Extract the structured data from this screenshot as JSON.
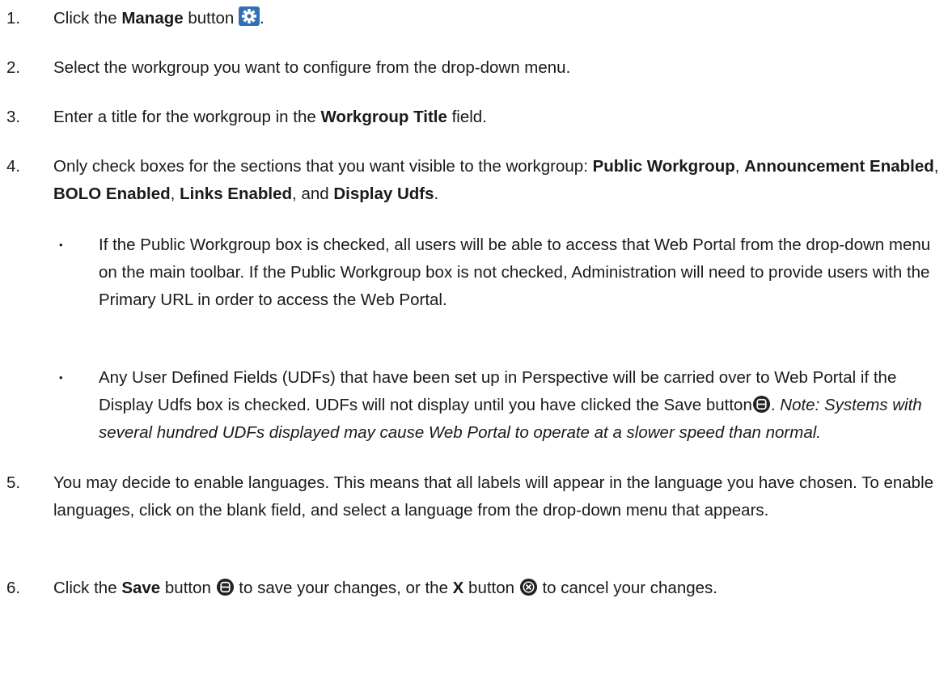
{
  "steps": [
    {
      "num": "1.",
      "pre": "Click the ",
      "bold": "Manage",
      "post": " button",
      "icon": "gear-icon",
      "tail": "."
    },
    {
      "num": "2.",
      "text": "Select the workgroup you want to configure from the drop-down menu."
    },
    {
      "num": "3.",
      "pre": "Enter a title for the workgroup in the ",
      "bold": "Workgroup Title",
      "post": " field."
    },
    {
      "num": "4.",
      "pre": "Only check boxes for the sections that you want visible to the workgroup: ",
      "items": [
        "Public Workgroup",
        "Announcement Enabled",
        "BOLO Enabled",
        "Links Enabled",
        "Display Udfs"
      ],
      "sep1": ", ",
      "sep_and": ", and ",
      "end": "."
    },
    {
      "num": "5.",
      "text": "You may decide to enable languages. This means that all labels will appear in the language you have chosen. To enable languages, click on the blank field, and select a language from the drop-down menu that appears."
    },
    {
      "num": "6.",
      "pre": "Click the ",
      "bold": "Save",
      "mid": " button ",
      "icon": "save-icon",
      "mid2": " to save your changes, or the ",
      "bold2": "X",
      "mid3": " button ",
      "icon2": "cancel-icon",
      "tail": " to cancel your changes."
    }
  ],
  "bullets": [
    {
      "bullet": "•",
      "text": "If the Public Workgroup box is checked, all users will be able to access that Web Portal from the drop-down menu on the main toolbar. If the Public Workgroup box is not checked, Administration will need to provide users with the Primary URL in order to access the Web Portal."
    },
    {
      "bullet": "•",
      "pre": "Any User Defined Fields (UDFs) that have been set up in Perspective will be carried over to Web Portal if the Display Udfs box is checked. UDFs will not display until you have clicked the Save button",
      "icon": "save-icon",
      "mid": ". ",
      "note": "Note: Systems with several hundred UDFs displayed may cause Web Portal to operate at a slower speed than normal."
    }
  ],
  "colors": {
    "gear_blue": "#2f6fb5",
    "icon_dark": "#222222"
  }
}
